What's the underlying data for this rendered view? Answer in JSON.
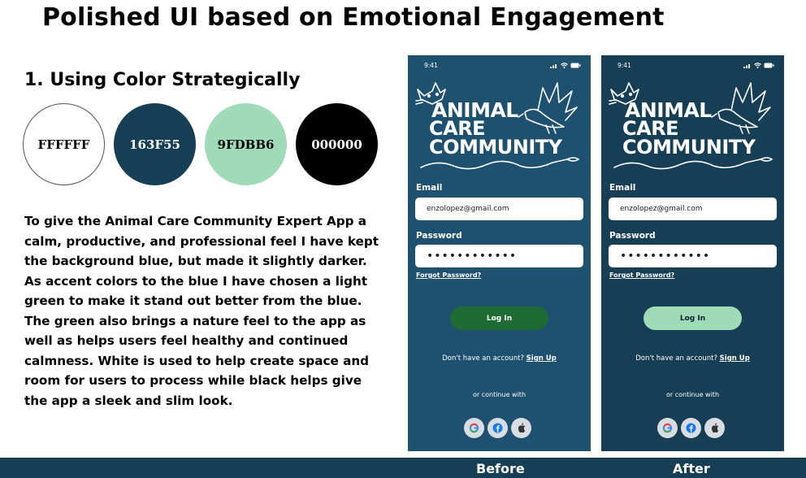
{
  "page": {
    "title": "Polished UI based on Emotional Engagement",
    "subtitle": "1.  Using Color Strategically",
    "description": "To give the Animal Care Community Expert App a calm, productive, and professional feel I have kept the background blue, but made it slightly darker. As accent colors to the blue I have chosen a light green to make it stand out better from the blue. The green also brings a nature feel to the app as well as helps users feel healthy and continued calmness. White is used to help create space and room for users to process while black helps give the app a sleek and slim look."
  },
  "swatches": [
    {
      "label": "FFFFFF",
      "color": "#FFFFFF"
    },
    {
      "label": "163F55",
      "color": "#163F55"
    },
    {
      "label": "9FDBB6",
      "color": "#9FDBB6"
    },
    {
      "label": "000000",
      "color": "#000000"
    }
  ],
  "footer": {
    "before_label": "Before",
    "after_label": "After",
    "band_color": "#163F55"
  },
  "phones": {
    "before": {
      "background": "#1E5070",
      "button_color": "#1E6B33"
    },
    "after": {
      "background": "#163F55",
      "button_color": "#9FDBB6"
    }
  },
  "app": {
    "time": "9:41",
    "logo_lines": [
      "ANIMAL",
      "CARE",
      "COMMUNITY"
    ],
    "email_label": "Email",
    "email_value": "enzolopez@gmail.com",
    "password_label": "Password",
    "password_value": "••••••••••••",
    "forgot_label": "Forgot Password?",
    "login_label": "Log In",
    "signup_prompt": "Don't have an account?",
    "signup_link": "Sign Up",
    "continue_label": "or continue with",
    "social_icons": [
      "google-icon",
      "facebook-icon",
      "apple-icon"
    ]
  }
}
